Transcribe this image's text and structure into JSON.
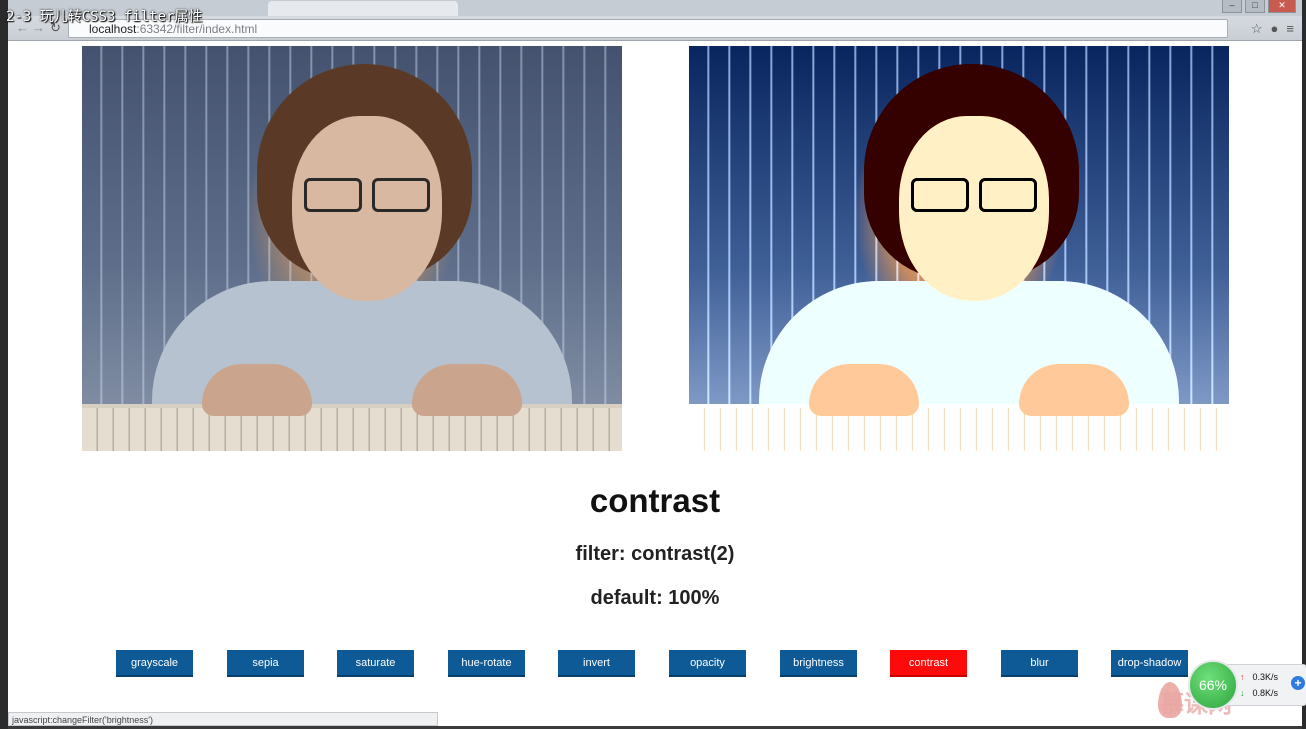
{
  "video": {
    "title": "2-3 玩儿转CSS3 filter属性"
  },
  "browser": {
    "url_host": "localhost",
    "url_path": ":63342/filter/index.html",
    "status_text": "javascript:changeFilter('brightness')"
  },
  "images": {
    "left": {
      "filter": "none"
    },
    "right": {
      "filter": "contrast(2)"
    }
  },
  "filter": {
    "name": "contrast",
    "usage": "filter: contrast(2)",
    "default": "default: 100%"
  },
  "buttons": [
    {
      "label": "grayscale",
      "active": false
    },
    {
      "label": "sepia",
      "active": false
    },
    {
      "label": "saturate",
      "active": false
    },
    {
      "label": "hue-rotate",
      "active": false
    },
    {
      "label": "invert",
      "active": false
    },
    {
      "label": "opacity",
      "active": false
    },
    {
      "label": "brightness",
      "active": false
    },
    {
      "label": "contrast",
      "active": true
    },
    {
      "label": "blur",
      "active": false
    },
    {
      "label": "drop-shadow",
      "active": false
    }
  ],
  "speed_widget": {
    "percent": "66%",
    "up": "0.3K/s",
    "down": "0.8K/s"
  },
  "watermark": {
    "text": "慕课网"
  },
  "colors": {
    "button_bg": "#0d5a96",
    "button_active_bg": "#ff0a0a",
    "text": "#111111"
  }
}
